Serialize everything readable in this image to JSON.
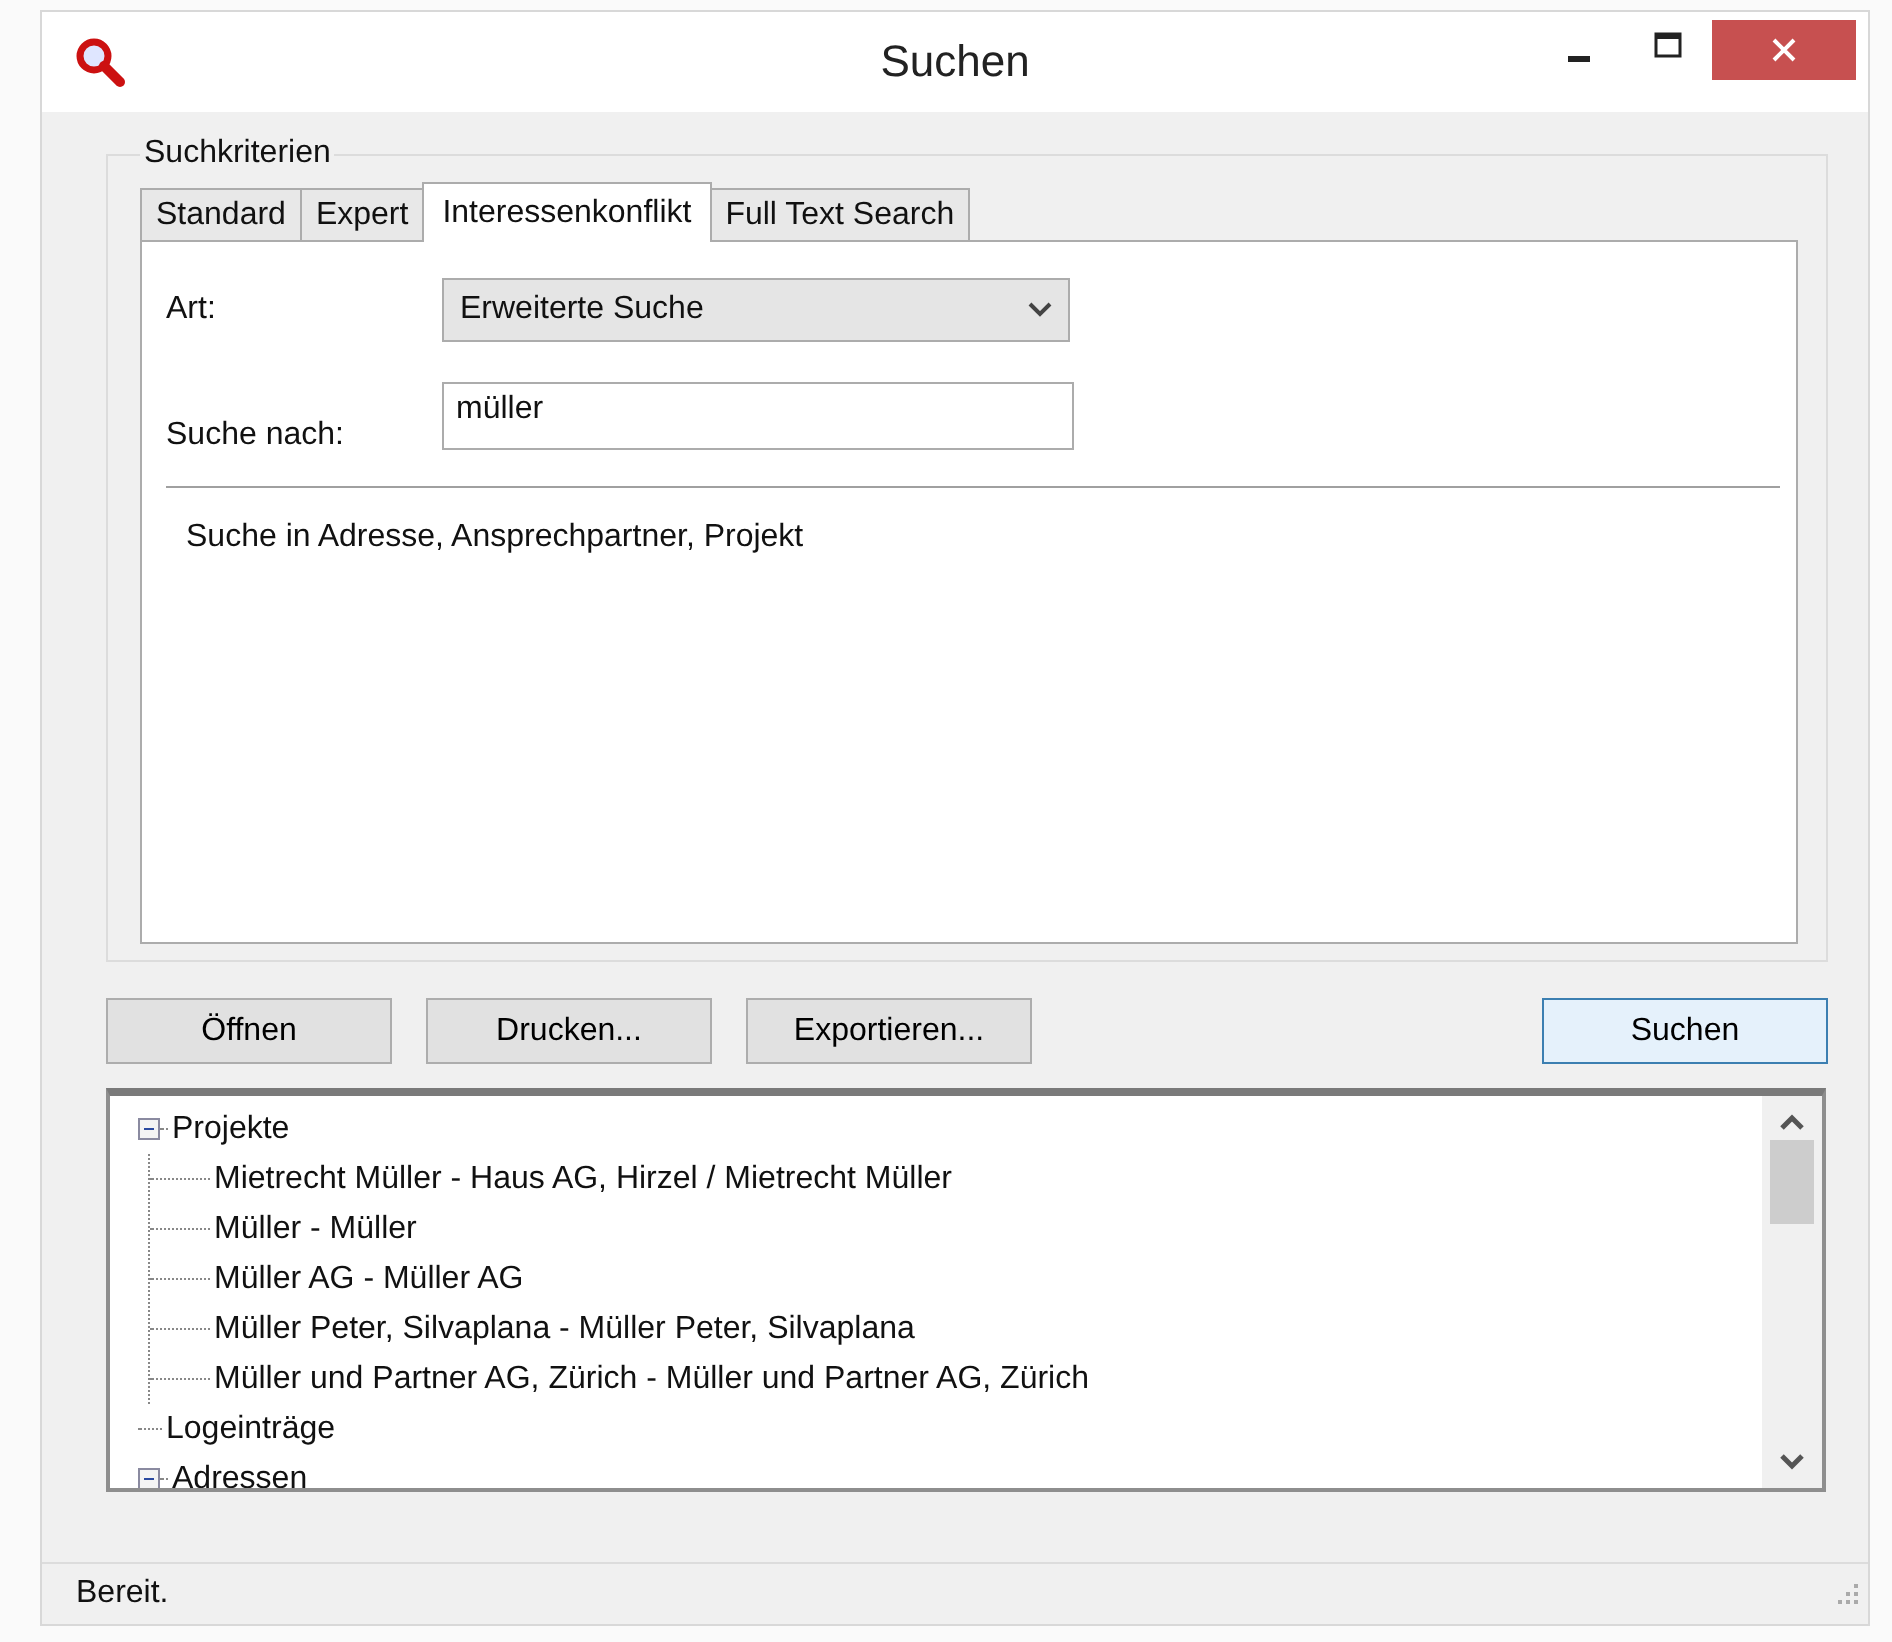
{
  "window": {
    "title": "Suchen"
  },
  "group": {
    "title": "Suchkriterien"
  },
  "tabs": [
    {
      "label": "Standard",
      "selected": false
    },
    {
      "label": "Expert",
      "selected": false
    },
    {
      "label": "Interessenkonflikt",
      "selected": true
    },
    {
      "label": "Full Text Search",
      "selected": false
    }
  ],
  "form": {
    "art_label": "Art:",
    "art_value": "Erweiterte Suche",
    "search_label": "Suche nach:",
    "search_value": "müller",
    "hint": "Suche in Adresse, Ansprechpartner, Projekt"
  },
  "buttons": [
    {
      "label": "Öffnen",
      "default": false
    },
    {
      "label": "Drucken...",
      "default": false
    },
    {
      "label": "Exportieren...",
      "default": false
    }
  ],
  "search_button": {
    "label": "Suchen",
    "default": true
  },
  "tree": [
    {
      "label": "Projekte",
      "expanded": true,
      "children": [
        {
          "label": "Mietrecht Müller - Haus AG, Hirzel / Mietrecht Müller"
        },
        {
          "label": "Müller - Müller"
        },
        {
          "label": "Müller AG - Müller AG"
        },
        {
          "label": "Müller Peter, Silvaplana - Müller Peter, Silvaplana"
        },
        {
          "label": "Müller und Partner AG, Zürich - Müller und Partner AG, Zürich"
        }
      ]
    },
    {
      "label": "Logeinträge"
    },
    {
      "label": "Adressen",
      "expanded": true
    }
  ],
  "status_bar": {
    "text": "Bereit."
  }
}
